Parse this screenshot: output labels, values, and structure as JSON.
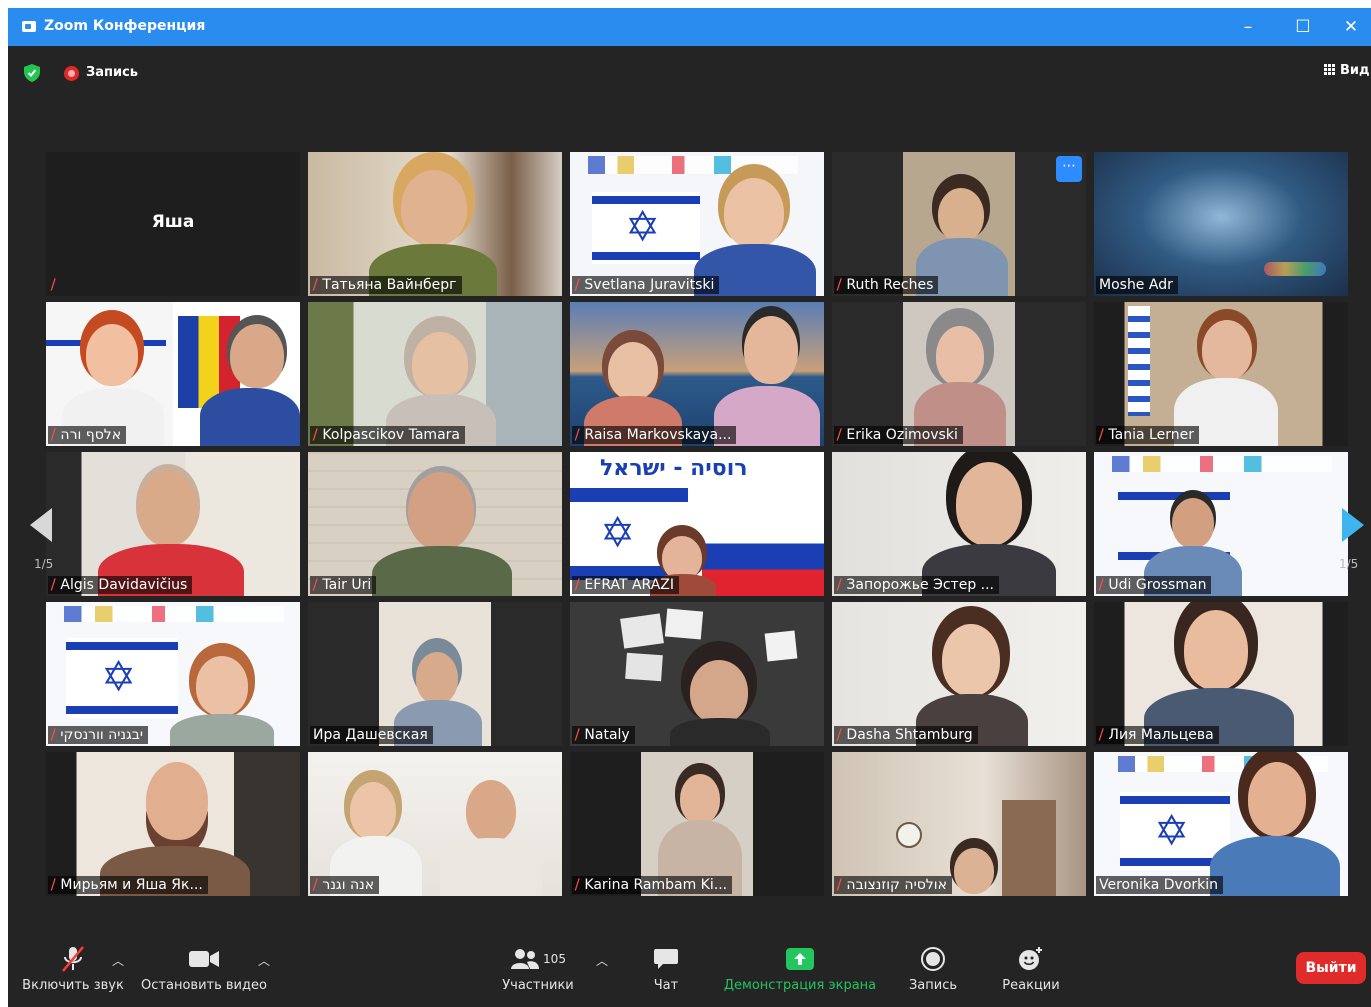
{
  "window": {
    "title": "Zoom Конференция",
    "minimize": "–",
    "maximize": "☐",
    "close": "✕"
  },
  "info_bar": {
    "recording_label": "Запись",
    "view_label": "Вид"
  },
  "gallery": {
    "page_left": "1/5",
    "page_right": "1/5",
    "tiles": [
      {
        "name": "Яша",
        "muted": true,
        "video": false,
        "display_name": "Яша"
      },
      {
        "name": "Татьяна Вайнберг",
        "muted": true
      },
      {
        "name": "Svetlana Juravitski",
        "muted": true
      },
      {
        "name": "Ruth Reches",
        "muted": true
      },
      {
        "name": "Moshe Adr",
        "muted": false
      },
      {
        "name": "אלסף ורה",
        "muted": true
      },
      {
        "name": "Kolpascikov Tamara",
        "muted": true
      },
      {
        "name": "Raisa Markovskaya...",
        "muted": true
      },
      {
        "name": "Erika Ozimovski",
        "muted": true
      },
      {
        "name": "Tania Lerner",
        "muted": true
      },
      {
        "name": "Algis Davidavičius",
        "muted": true
      },
      {
        "name": "Tair Uri",
        "muted": true
      },
      {
        "name": "EFRAT ARAZI",
        "muted": true,
        "banner": "רוסיה - ישראל"
      },
      {
        "name": "Запорожье Эстер ...",
        "muted": true
      },
      {
        "name": "Udi Grossman",
        "muted": true
      },
      {
        "name": "יבגניה וורנסקי",
        "muted": true
      },
      {
        "name": "Ира Дашевская",
        "muted": false
      },
      {
        "name": "Nataly",
        "muted": true
      },
      {
        "name": "Dasha Shtamburg",
        "muted": true
      },
      {
        "name": "Лия Мальцева",
        "muted": true
      },
      {
        "name": "Мирьям и Яша Як...",
        "muted": true
      },
      {
        "name": "אנה וגנר",
        "muted": true
      },
      {
        "name": "Karina Rambam Ki...",
        "muted": true
      },
      {
        "name": "אולסיה קוזנצובה",
        "muted": true
      },
      {
        "name": "Veronika Dvorkin",
        "muted": false,
        "active_speaker": true
      }
    ]
  },
  "toolbar": {
    "mute_label": "Включить звук",
    "video_label": "Остановить видео",
    "participants_label": "Участники",
    "participants_count": "105",
    "chat_label": "Чат",
    "share_label": "Демонстрация экрана",
    "record_label": "Запись",
    "reactions_label": "Реакции",
    "leave_label": "Выйти"
  },
  "colors": {
    "titlebar": "#2b8cf0",
    "background": "#242424",
    "leave": "#e02b2b",
    "share": "#22c55e",
    "active_speaker": "#e8e87a"
  }
}
